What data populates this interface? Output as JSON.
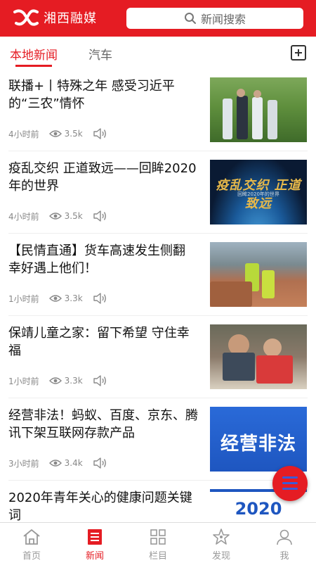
{
  "header": {
    "app_name": "湘西融媒",
    "search_placeholder": "新闻搜索",
    "brand_color": "#e51c23"
  },
  "tabs": [
    {
      "label": "本地新闻",
      "active": true
    },
    {
      "label": "汽车",
      "active": false
    }
  ],
  "news": [
    {
      "title": "联播+丨特殊之年 感受习近平的“三农”情怀",
      "time": "4小时前",
      "views": "3.5k"
    },
    {
      "title": "疫乱交织 正道致远——回眸2020年的世界",
      "time": "4小时前",
      "views": "3.5k",
      "thumb_text": "疫乱交织 正道致远",
      "thumb_subtext": "回眸2020年的世界"
    },
    {
      "title": "【民情直通】货车高速发生侧翻 幸好遇上他们！",
      "time": "1小时前",
      "views": "3.3k"
    },
    {
      "title": "保靖儿童之家：留下希望 守住幸福",
      "time": "1小时前",
      "views": "3.3k"
    },
    {
      "title": "经营非法！蚂蚁、百度、京东、腾讯下架互联网存款产品",
      "time": "3小时前",
      "views": "3.4k",
      "thumb_text": "经营非法"
    },
    {
      "title": "2020年青年关心的健康问题关键词",
      "thumb_text": "2020"
    }
  ],
  "bottom_nav": [
    {
      "label": "首页",
      "icon": "home-icon",
      "active": false
    },
    {
      "label": "新闻",
      "icon": "news-icon",
      "active": true
    },
    {
      "label": "栏目",
      "icon": "grid-icon",
      "active": false
    },
    {
      "label": "发现",
      "icon": "discover-icon",
      "active": false
    },
    {
      "label": "我",
      "icon": "profile-icon",
      "active": false
    }
  ],
  "icons": {
    "search": "search-icon",
    "add_tab": "plus-square-icon",
    "views": "eye-icon",
    "audio": "speaker-icon",
    "fab": "menu-icon"
  }
}
